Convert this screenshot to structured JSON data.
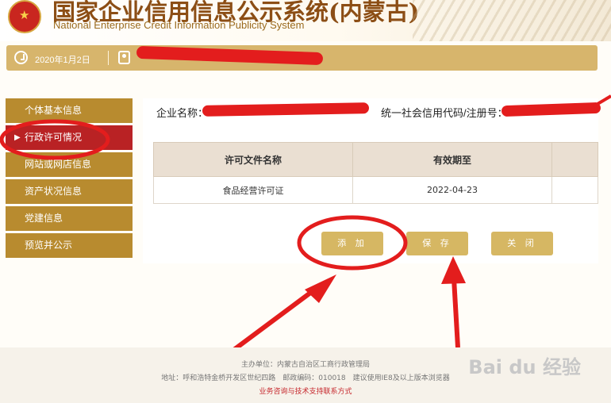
{
  "header": {
    "title": "国家企业信用信息公示系统(内蒙古)",
    "subtitle": "National Enterprise Credit Information Publicity System"
  },
  "topbar": {
    "date": "2020年1月2日"
  },
  "sidebar": {
    "items": [
      {
        "label": "个体基本信息"
      },
      {
        "label": "行政许可情况",
        "active": true
      },
      {
        "label": "网站或网店信息"
      },
      {
        "label": "资产状况信息"
      },
      {
        "label": "党建信息"
      },
      {
        "label": "预览并公示"
      }
    ]
  },
  "main": {
    "company_label": "企业名称：",
    "code_label": "统一社会信用代码/注册号：",
    "table": {
      "headers": [
        "许可文件名称",
        "有效期至"
      ],
      "rows": [
        [
          "食品经营许可证",
          "2022-04-23"
        ]
      ]
    },
    "buttons": {
      "add": "添 加",
      "save": "保 存",
      "close": "关 闭"
    }
  },
  "footer": {
    "host": "主办单位：内蒙古自治区工商行政管理局",
    "address": "地址：呼和浩特金桥开发区世纪四路　邮政编码：010018　建议使用IE8及以上版本浏览器",
    "support": "业务咨询与技术支持联系方式"
  },
  "watermark": {
    "text": "Bai du 经验"
  },
  "colors": {
    "gold": "#d7b56c",
    "brown": "#b88b2f",
    "active": "#b92224",
    "annotation": "#e31d1d"
  }
}
